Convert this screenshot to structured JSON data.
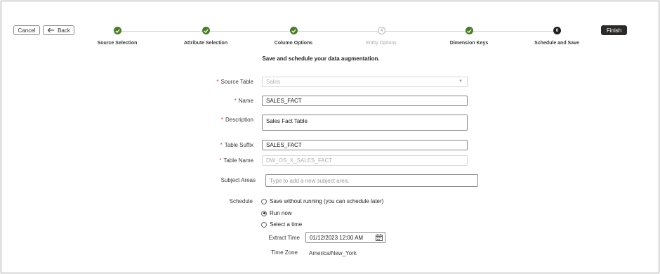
{
  "toolbar": {
    "cancel_label": "Cancel",
    "back_label": "Back",
    "finish_label": "Finish"
  },
  "steps": [
    {
      "label": "Source Selection",
      "state": "done",
      "marker": ""
    },
    {
      "label": "Attribute Selection",
      "state": "done",
      "marker": ""
    },
    {
      "label": "Column Options",
      "state": "done",
      "marker": ""
    },
    {
      "label": "Entity Options",
      "state": "disabled",
      "marker": "4"
    },
    {
      "label": "Dimension Keys",
      "state": "done",
      "marker": ""
    },
    {
      "label": "Schedule and Save",
      "state": "current",
      "marker": "6"
    }
  ],
  "subtitle": "Save and schedule your data augmentation.",
  "form": {
    "source_table": {
      "label": "Source Table",
      "value": "Sales",
      "required": true
    },
    "name": {
      "label": "Name",
      "value": "SALES_FACT",
      "required": true
    },
    "description": {
      "label": "Description",
      "value": "Sales Fact Table",
      "required": true
    },
    "table_suffix": {
      "label": "Table Suffix",
      "value": "SALES_FACT",
      "required": true
    },
    "table_name": {
      "label": "Table Name",
      "value": "DW_OS_X_SALES_FACT",
      "required": true
    },
    "subject_areas": {
      "label": "Subject Areas",
      "placeholder": "Type to add a new subject area."
    },
    "schedule": {
      "label": "Schedule",
      "options": [
        {
          "label": "Save without running (you can schedule later)",
          "checked": false
        },
        {
          "label": "Run now",
          "checked": true
        },
        {
          "label": "Select a time",
          "checked": false
        }
      ]
    },
    "extract_time": {
      "label": "Extract Time",
      "value": "01/12/2023 12:00 AM"
    },
    "time_zone": {
      "label": "Time Zone",
      "value": "America/New_York"
    }
  }
}
